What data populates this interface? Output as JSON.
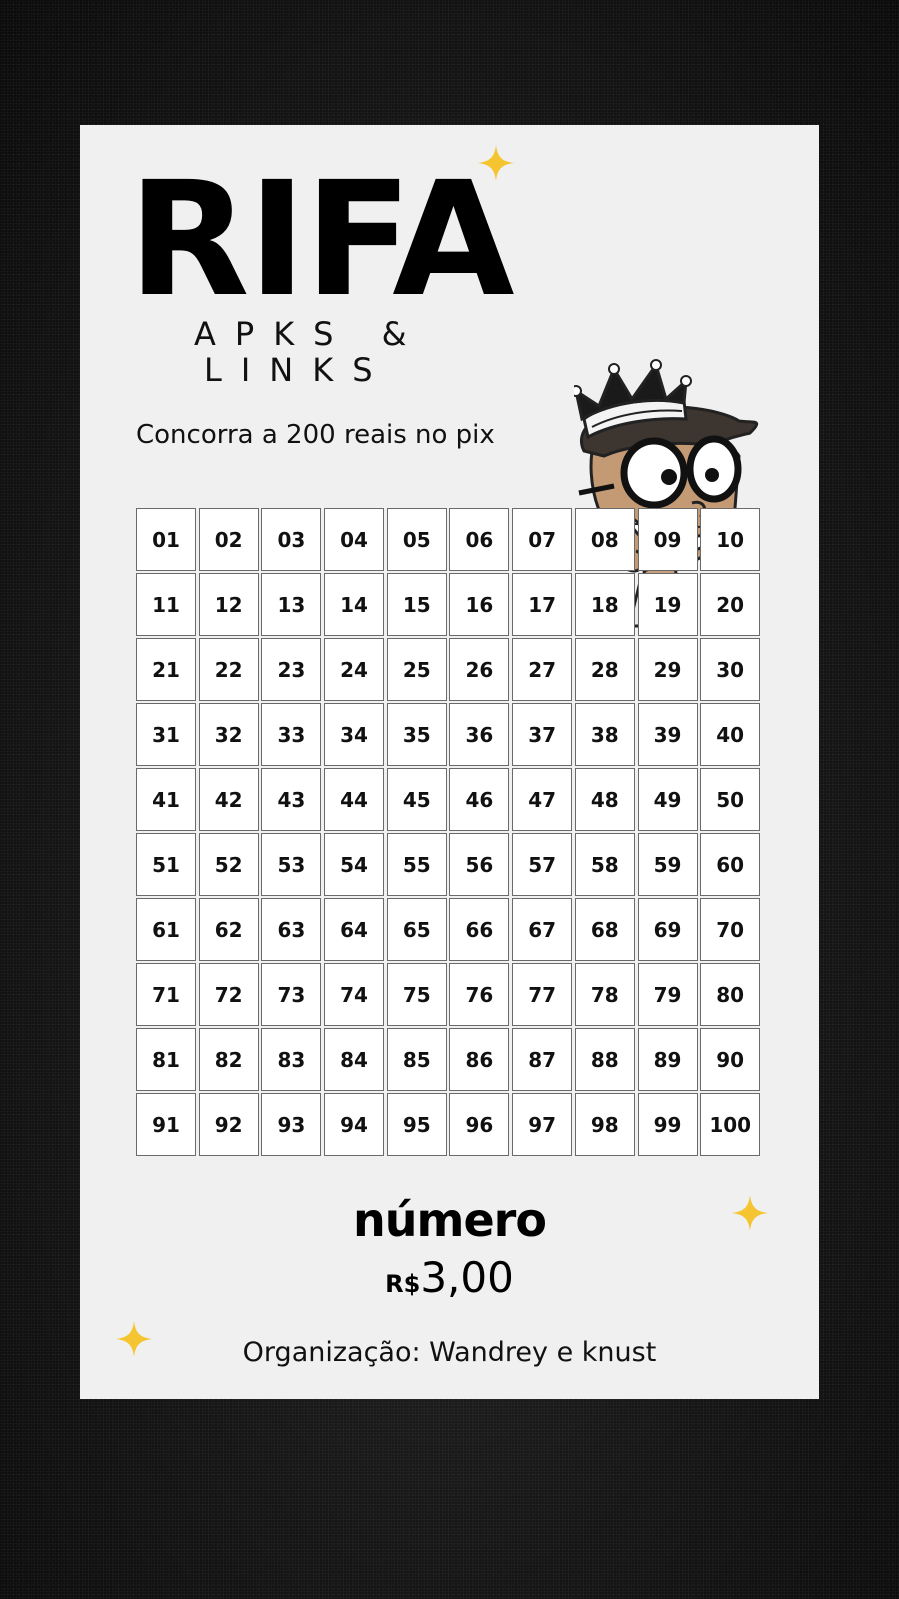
{
  "title": "RIFA",
  "subtitle_line1": "APKS &",
  "subtitle_line2": "LINKS",
  "tagline": "Concorra a 200 reais no pix",
  "numbers": [
    "01",
    "02",
    "03",
    "04",
    "05",
    "06",
    "07",
    "08",
    "09",
    "10",
    "11",
    "12",
    "13",
    "14",
    "15",
    "16",
    "17",
    "18",
    "19",
    "20",
    "21",
    "22",
    "23",
    "24",
    "25",
    "26",
    "27",
    "28",
    "29",
    "30",
    "31",
    "32",
    "33",
    "34",
    "35",
    "36",
    "37",
    "38",
    "39",
    "40",
    "41",
    "42",
    "43",
    "44",
    "45",
    "46",
    "47",
    "48",
    "49",
    "50",
    "51",
    "52",
    "53",
    "54",
    "55",
    "56",
    "57",
    "58",
    "59",
    "60",
    "61",
    "62",
    "63",
    "64",
    "65",
    "66",
    "67",
    "68",
    "69",
    "70",
    "71",
    "72",
    "73",
    "74",
    "75",
    "76",
    "77",
    "78",
    "79",
    "80",
    "81",
    "82",
    "83",
    "84",
    "85",
    "86",
    "87",
    "88",
    "89",
    "90",
    "91",
    "92",
    "93",
    "94",
    "95",
    "96",
    "97",
    "98",
    "99",
    "100"
  ],
  "price_label": "número",
  "price_currency": "R$",
  "price_value": "3,00",
  "organizer": "Organização: Wandrey e knust",
  "colors": {
    "background": "#151515",
    "card": "#f0f0f0",
    "sparkle": "#f5c531",
    "text": "#000000"
  },
  "icons": [
    "sparkle-icon",
    "cartoon-mascot-with-crown"
  ]
}
